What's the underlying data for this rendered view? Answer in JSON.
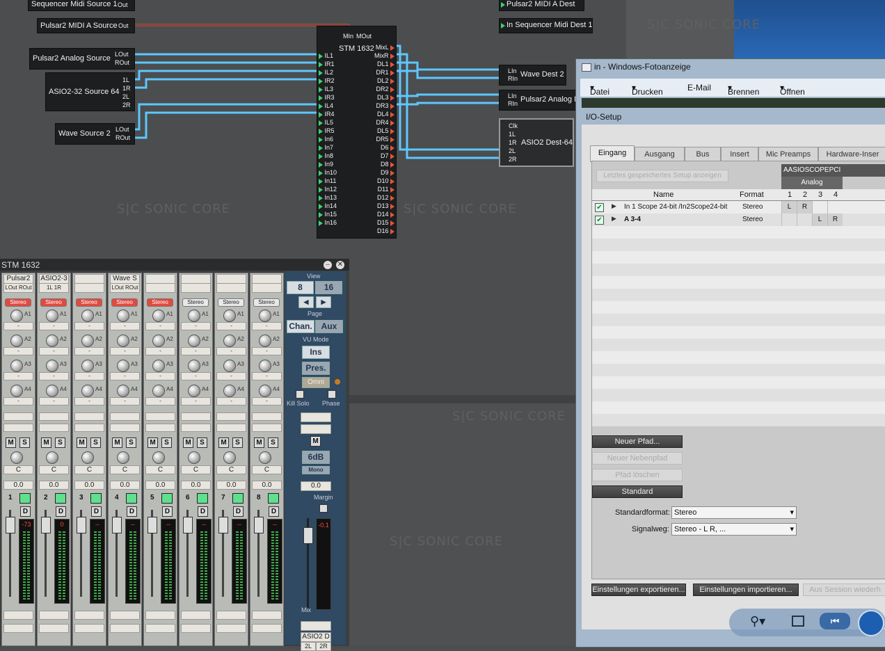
{
  "watermark": "S|C SONIC CORE",
  "sources": {
    "seq_midi": {
      "name": "Sequencer Midi Source 1",
      "port": "Out"
    },
    "pulsar_midi": {
      "name": "Pulsar2 MIDI A Source",
      "port": "Out"
    },
    "pulsar_analog": {
      "name": "Pulsar2 Analog Source",
      "ports": [
        "LOut",
        "ROut"
      ]
    },
    "asio": {
      "name": "ASIO2-32 Source 64",
      "ports": [
        "1L",
        "1R",
        "2L",
        "2R"
      ]
    },
    "wave": {
      "name": "Wave Source 2",
      "ports": [
        "LOut",
        "ROut"
      ]
    }
  },
  "dests": {
    "pulsar_midi": "Pulsar2 MIDI A Dest",
    "seq_midi": "In Sequencer Midi Dest 1",
    "wave": {
      "name": "Wave Dest 2",
      "ports": [
        "LIn",
        "RIn"
      ]
    },
    "pulsar_analog": {
      "name": "Pulsar2 Analog I",
      "ports": [
        "LIn",
        "RIn"
      ]
    },
    "asio": {
      "name": "ASIO2 Dest-64",
      "ports": [
        "Clk",
        "1L",
        "1R",
        "2L",
        "2R"
      ]
    }
  },
  "stm": {
    "title": "STM 1632",
    "midi_in": "MIn",
    "midi_out": "MOut",
    "inputs": [
      "IL1",
      "IR1",
      "IL2",
      "IR2",
      "IL3",
      "IR3",
      "IL4",
      "IR4",
      "IL5",
      "IR5",
      "In6",
      "In7",
      "In8",
      "In9",
      "In10",
      "In11",
      "In12",
      "In13",
      "In14",
      "In15",
      "In16"
    ],
    "outputs": [
      "MixL",
      "MixR",
      "DL1",
      "DR1",
      "DL2",
      "DR2",
      "DL3",
      "DR3",
      "DL4",
      "DR4",
      "DL5",
      "DR5",
      "D6",
      "D7",
      "D8",
      "D9",
      "D10",
      "D11",
      "D12",
      "D13",
      "D14",
      "D15",
      "D16"
    ]
  },
  "mixer": {
    "title": "STM 1632",
    "strips": [
      {
        "name": "Pulsar2",
        "l": "LOut",
        "r": "ROut",
        "mode": "Stereo",
        "active": true,
        "num": "1",
        "meter": "-73"
      },
      {
        "name": "ASIO2-3",
        "l": "1L",
        "r": "1R",
        "mode": "Stereo",
        "active": true,
        "num": "2",
        "meter": "0"
      },
      {
        "name": "",
        "l": "",
        "r": "",
        "mode": "Stereo",
        "active": true,
        "num": "3",
        "meter": "--"
      },
      {
        "name": "Wave S",
        "l": "LOut",
        "r": "ROut",
        "mode": "Stereo",
        "active": true,
        "num": "4",
        "meter": "--"
      },
      {
        "name": "",
        "l": "",
        "r": "",
        "mode": "Stereo",
        "active": true,
        "num": "5",
        "meter": "--"
      },
      {
        "name": "",
        "l": "",
        "r": "",
        "mode": "Stereo",
        "active": false,
        "num": "6",
        "meter": "--"
      },
      {
        "name": "",
        "l": "",
        "r": "",
        "mode": "Stereo",
        "active": false,
        "num": "7",
        "meter": "--"
      },
      {
        "name": "",
        "l": "",
        "r": "",
        "mode": "Stereo",
        "active": false,
        "num": "8",
        "meter": "--"
      }
    ],
    "aux": [
      "A1",
      "A2",
      "A3",
      "A4"
    ],
    "mute": "M",
    "solo": "S",
    "pan": "C",
    "vol": "0.0",
    "d": "D",
    "view": {
      "title": "View",
      "b8": "8",
      "b16": "16",
      "page": "Page",
      "chan": "Chan.",
      "aux": "Aux",
      "vu": "VU Mode",
      "ins": "Ins",
      "pres": "Pres.",
      "omni": "Omni",
      "kill_solo": "Kill Solo",
      "phase": "Phase",
      "m": "M",
      "db": "6dB",
      "mono": "Mono",
      "vol": "0.0",
      "margin": "Margin",
      "meter": "-0.1",
      "mix": "Mix",
      "out_name": "ASIO2 D",
      "out_l": "2L",
      "out_r": "2R"
    }
  },
  "window": {
    "title": "in - Windows-Fotoanzeige",
    "menu": [
      "Datei",
      "Drucken",
      "E-Mail",
      "Brennen",
      "Öffnen"
    ],
    "panel_title": "I/O-Setup",
    "tabs": [
      "Eingang",
      "Ausgang",
      "Bus",
      "Insert",
      "Mic Preamps",
      "Hardware-Inser"
    ],
    "load_last": "Letztes gespeichertes Setup anzeigen",
    "device": "AASIOSCOPEPCI",
    "group": "Analog",
    "cols": {
      "name": "Name",
      "format": "Format",
      "ch": [
        "1",
        "2",
        "3",
        "4"
      ]
    },
    "rows": [
      {
        "name": "In 1 Scope 24-bit /In2Scope24-bit",
        "format": "Stereo",
        "assign": [
          "L",
          "R",
          "",
          ""
        ]
      },
      {
        "name": "A 3-4",
        "format": "Stereo",
        "assign": [
          "",
          "",
          "L",
          "R"
        ]
      }
    ],
    "buttons": {
      "new_path": "Neuer Pfad...",
      "new_sub": "Neuer Nebenpfad",
      "delete": "Pfad löschen",
      "default": "Standard",
      "export": "Einstellungen exportieren...",
      "import": "Einstellungen importieren...",
      "from_session": "Aus Session wiederh"
    },
    "std_format_label": "Standardformat:",
    "std_format": "Stereo",
    "signal_label": "Signalweg:",
    "signal": "Stereo - L R, ..."
  }
}
